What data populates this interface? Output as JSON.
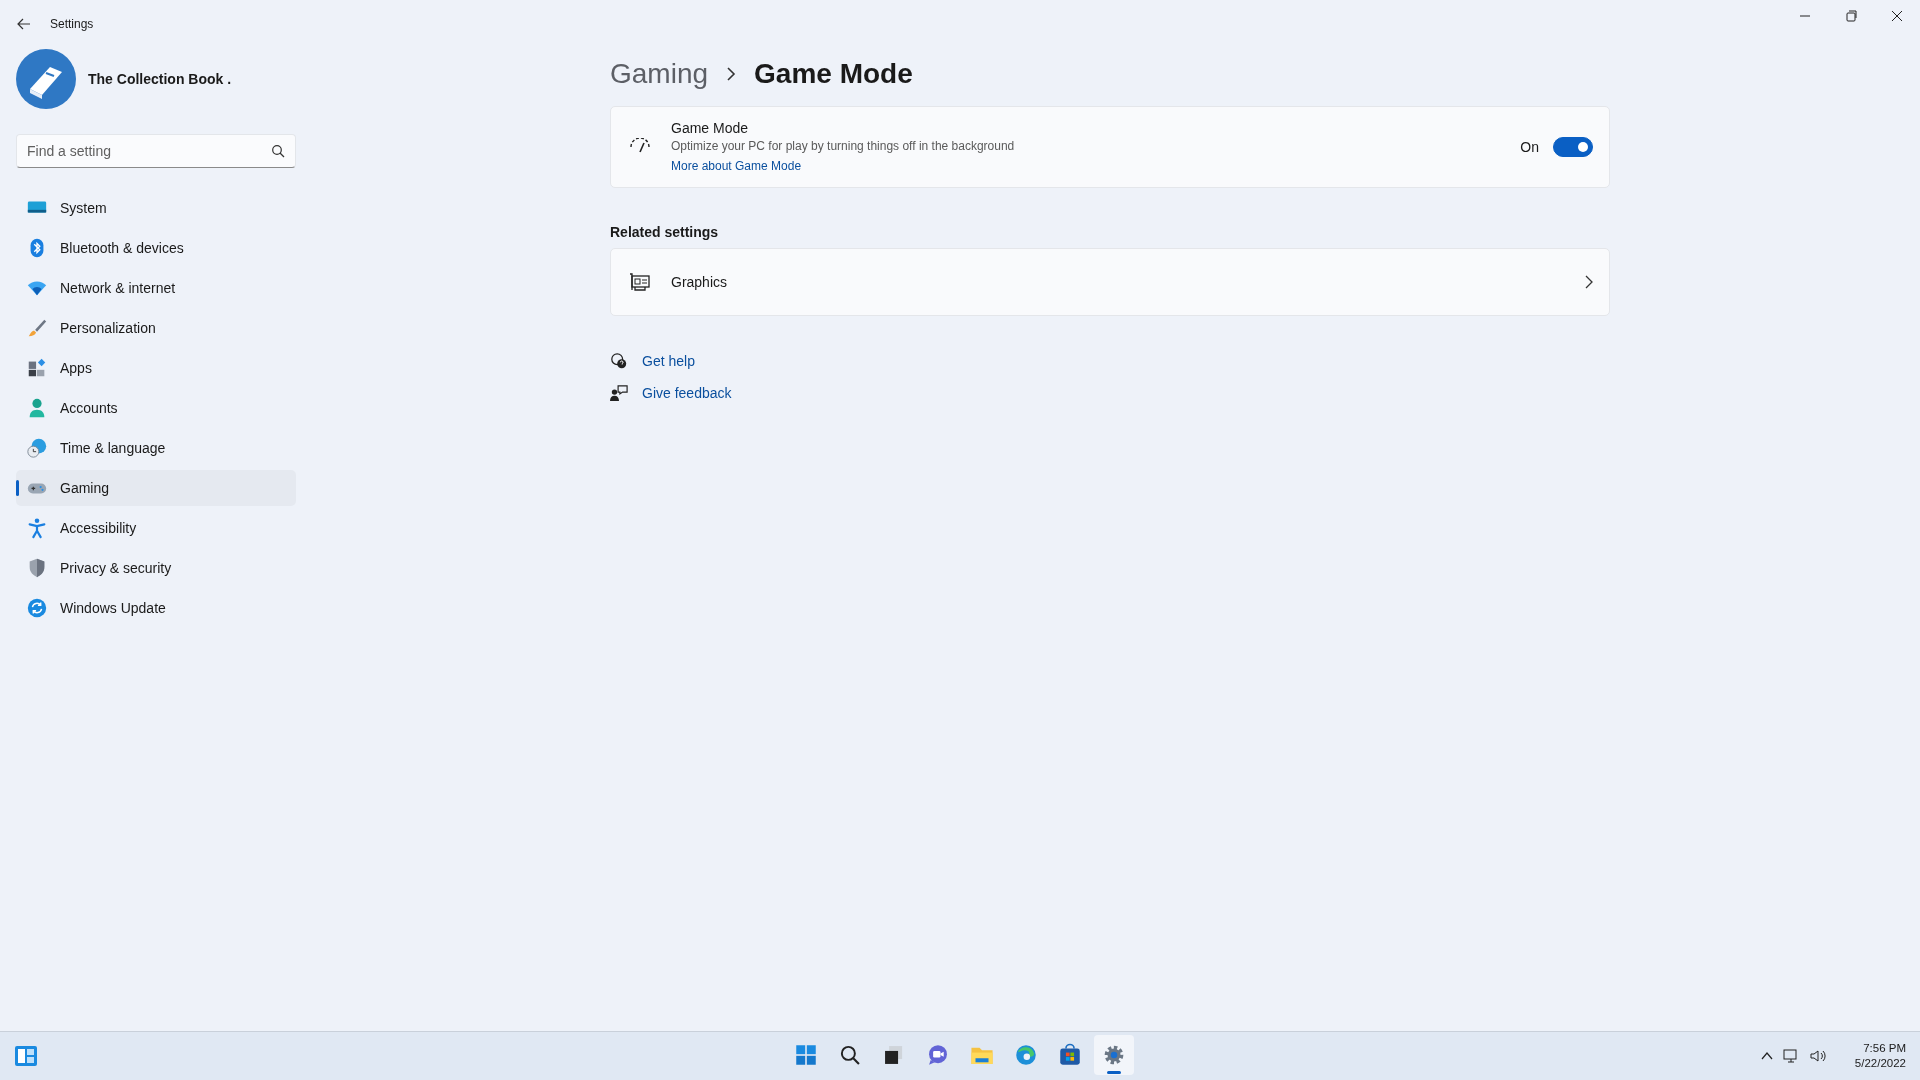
{
  "window": {
    "title": "Settings"
  },
  "profile": {
    "name": "The Collection Book ."
  },
  "search": {
    "placeholder": "Find a setting"
  },
  "nav": [
    {
      "kind": "system",
      "label": "System",
      "selected": false
    },
    {
      "kind": "bluetooth",
      "label": "Bluetooth & devices",
      "selected": false
    },
    {
      "kind": "network",
      "label": "Network & internet",
      "selected": false
    },
    {
      "kind": "personalization",
      "label": "Personalization",
      "selected": false
    },
    {
      "kind": "apps",
      "label": "Apps",
      "selected": false
    },
    {
      "kind": "accounts",
      "label": "Accounts",
      "selected": false
    },
    {
      "kind": "time",
      "label": "Time & language",
      "selected": false
    },
    {
      "kind": "gaming",
      "label": "Gaming",
      "selected": true
    },
    {
      "kind": "accessibility",
      "label": "Accessibility",
      "selected": false
    },
    {
      "kind": "privacy",
      "label": "Privacy & security",
      "selected": false
    },
    {
      "kind": "update",
      "label": "Windows Update",
      "selected": false
    }
  ],
  "breadcrumb": {
    "parent": "Gaming",
    "current": "Game Mode"
  },
  "game_mode": {
    "title": "Game Mode",
    "description": "Optimize your PC for play by turning things off in the background",
    "link": "More about Game Mode",
    "state_label": "On",
    "on": true
  },
  "related": {
    "heading": "Related settings",
    "items": [
      {
        "label": "Graphics"
      }
    ]
  },
  "help_links": [
    {
      "kind": "help",
      "label": "Get help"
    },
    {
      "kind": "feedback",
      "label": "Give feedback"
    }
  ],
  "taskbar": {
    "apps": [
      {
        "kind": "start",
        "selected": false
      },
      {
        "kind": "search",
        "selected": false
      },
      {
        "kind": "task-view",
        "selected": false
      },
      {
        "kind": "chat",
        "selected": false
      },
      {
        "kind": "explorer",
        "selected": false
      },
      {
        "kind": "browser",
        "selected": false
      },
      {
        "kind": "store",
        "selected": false
      },
      {
        "kind": "settings",
        "selected": true
      }
    ],
    "time": "7:56 PM",
    "date": "5/22/2022"
  }
}
